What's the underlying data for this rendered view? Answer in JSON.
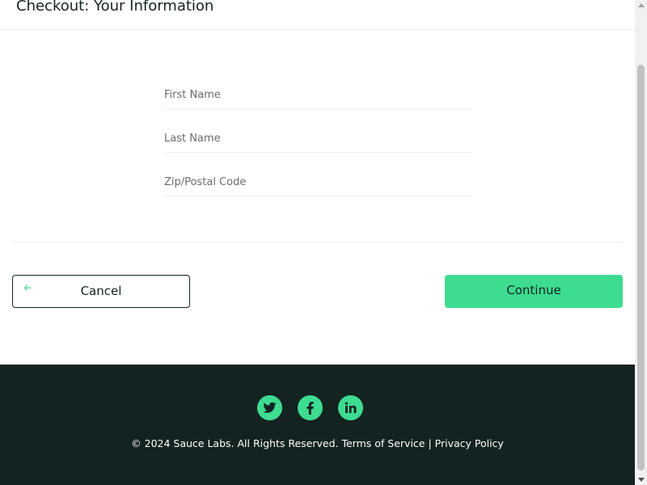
{
  "header": {
    "title": "Checkout: Your Information"
  },
  "form": {
    "first_name": {
      "value": "",
      "placeholder": "First Name"
    },
    "last_name": {
      "value": "",
      "placeholder": "Last Name"
    },
    "postal_code": {
      "value": "",
      "placeholder": "Zip/Postal Code"
    }
  },
  "actions": {
    "cancel_label": "Cancel",
    "cancel_icon": "arrow-left-icon",
    "continue_label": "Continue"
  },
  "footer": {
    "social": [
      {
        "name": "Twitter",
        "icon": "twitter-icon"
      },
      {
        "name": "Facebook",
        "icon": "facebook-icon"
      },
      {
        "name": "LinkedIn",
        "icon": "linkedin-icon"
      }
    ],
    "copy": "© 2024 Sauce Labs. All Rights Reserved. Terms of Service | Privacy Policy"
  },
  "colors": {
    "accent": "#3ddc91",
    "dark": "#132322",
    "divider": "#ededed"
  }
}
